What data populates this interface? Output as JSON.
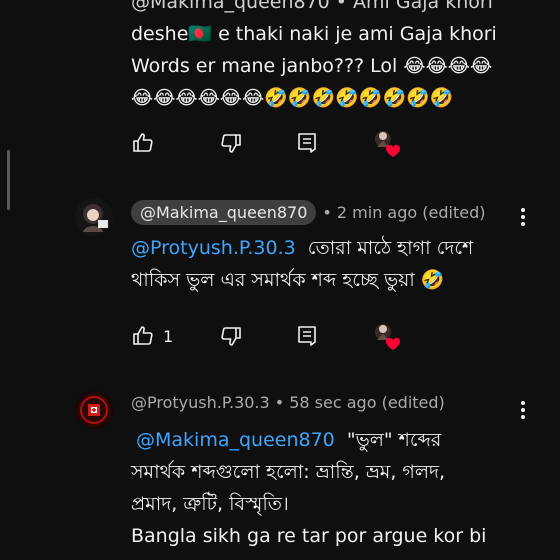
{
  "comment1": {
    "header_partial": "@Makima_queen870 • Ami Gaja khori",
    "lines": [
      "deshe🇧🇩 e thaki naki je ami Gaja khori",
      "Words er mane janbo??? Lol 😂😂😂😂",
      "😂😂😂😂😂😂🤣🤣🤣🤣🤣🤣🤣🤣"
    ]
  },
  "comment2": {
    "author": "@Makima_queen870",
    "meta": "• 2 min ago (edited)",
    "mention": "@Protyush.P.30.3",
    "line1_rest": "  তোরা মাঠে হাগা দেশে",
    "line2": "থাকিস ভুল এর সমার্থক শব্দ হচ্ছে ভুয়া 🤣",
    "like_count": "1"
  },
  "comment3": {
    "author": "@Protyush.P.30.3",
    "meta": "• 58 sec ago (edited)",
    "mention": "@Makima_queen870",
    "line1_rest": "  \"ভুল\" শব্দের",
    "line2": "সমার্থক শব্দগুলো হলো: ভ্রান্তি, ভ্রম, গলদ,",
    "line3": "প্রমাদ, ত্রুটি, বিস্মৃতি।",
    "line4": "Bangla sikh ga re tar por argue kor bi"
  },
  "icons": {
    "like": "thumbs-up-icon",
    "dislike": "thumbs-down-icon",
    "reply": "reply-comment-icon",
    "heart": "creator-heart-icon",
    "menu": "more-vert-icon"
  },
  "colors": {
    "background": "#0f0f0f",
    "mention": "#3ea6ff",
    "heart": "#ff0033",
    "chip": "#3f3f3f"
  }
}
